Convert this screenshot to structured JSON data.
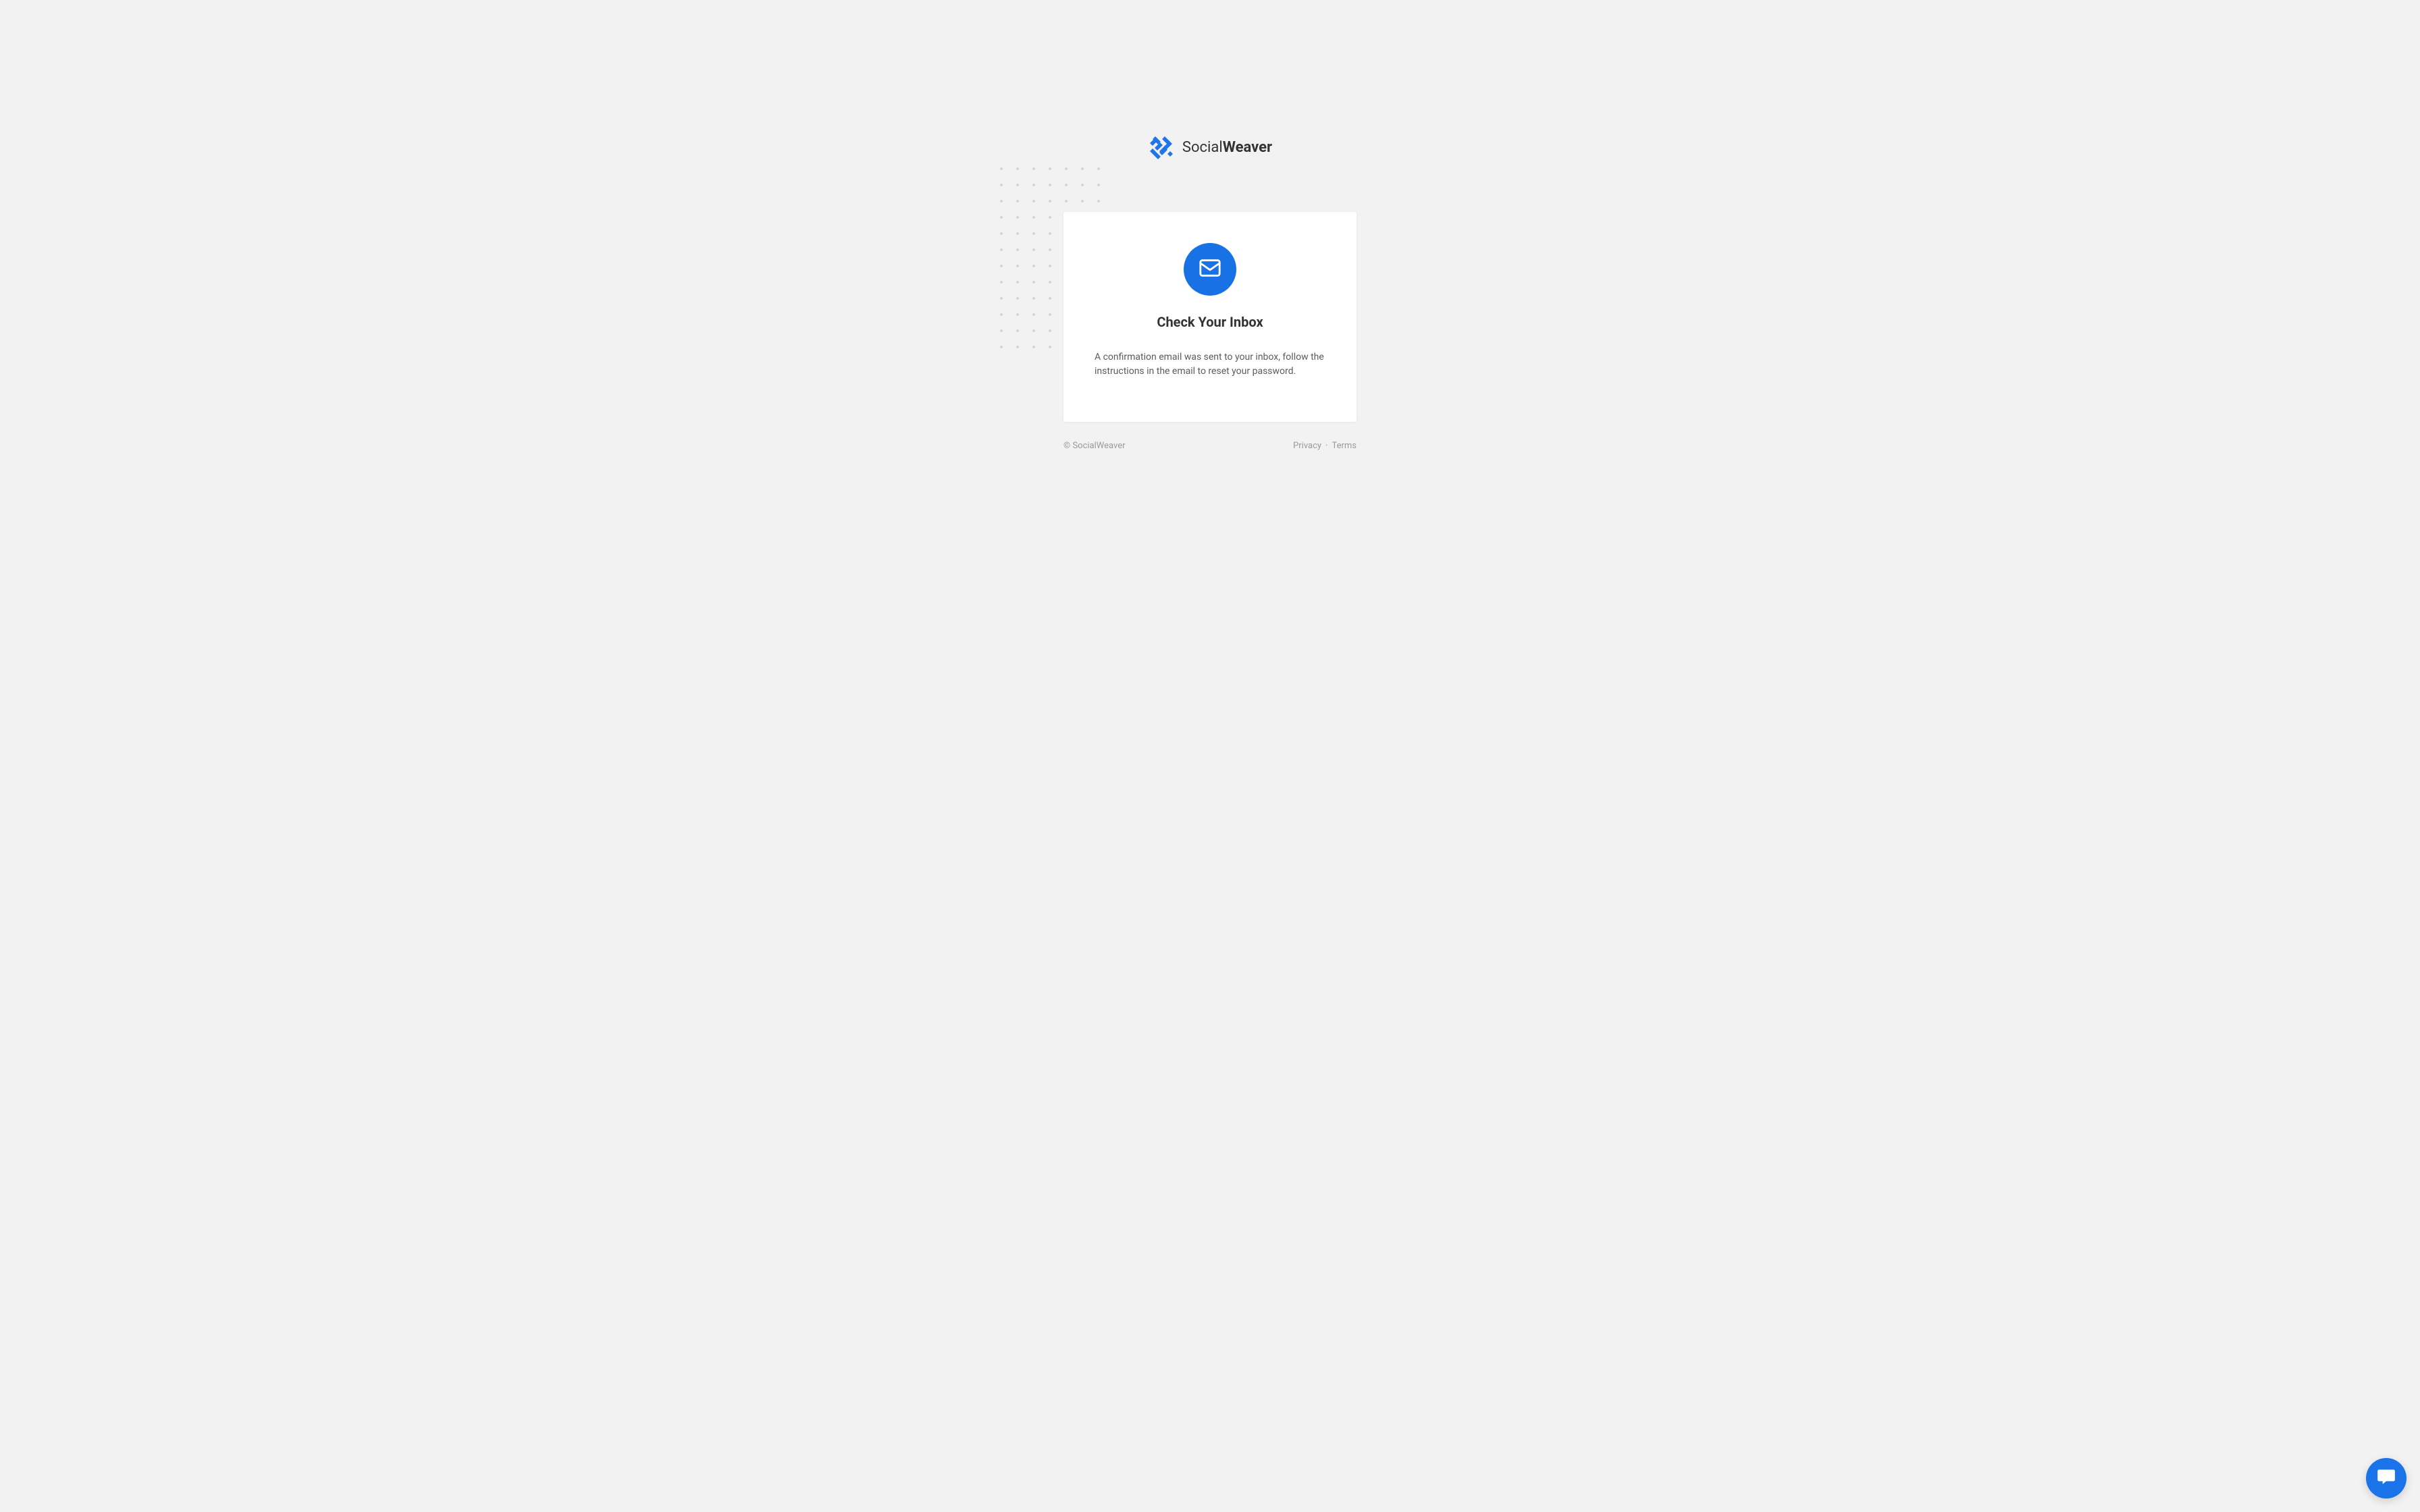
{
  "brand": {
    "name_light": "Social",
    "name_bold": "Weaver"
  },
  "card": {
    "heading": "Check Your Inbox",
    "description": "A confirmation email was sent to your inbox, follow the instructions in the email to reset your password."
  },
  "footer": {
    "copyright": "© SocialWeaver",
    "privacy_label": "Privacy",
    "separator": "·",
    "terms_label": "Terms"
  }
}
